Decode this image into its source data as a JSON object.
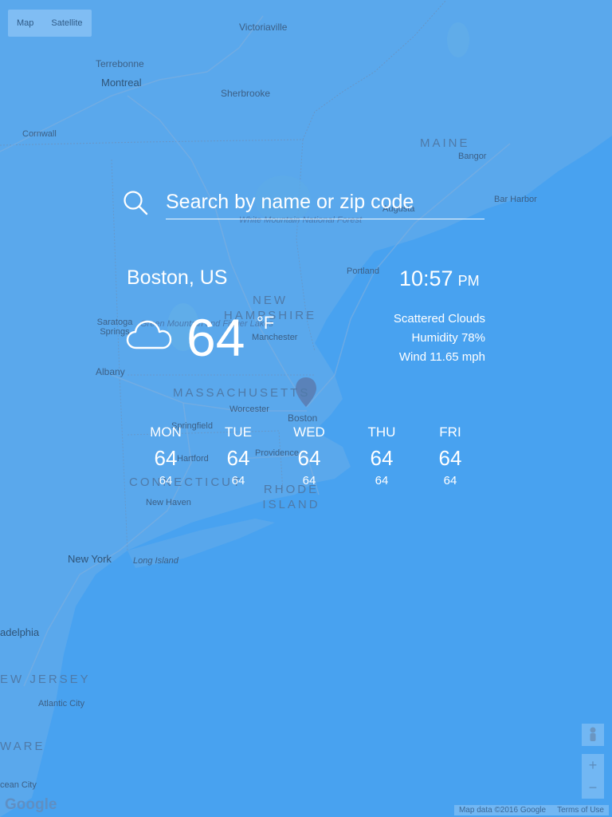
{
  "map": {
    "type_buttons": [
      "Map",
      "Satellite"
    ],
    "labels": {
      "victoriaville": "Victoriaville",
      "terrebonne": "Terrebonne",
      "montreal": "Montreal",
      "sherbrooke": "Sherbrooke",
      "cornwall": "Cornwall",
      "maine": "MAINE",
      "bangor": "Bangor",
      "bar_harbor": "Bar Harbor",
      "augusta": "Augusta",
      "white_mountain": "White Mountain National Forest",
      "portland": "Portland",
      "new_hampshire": "NEW HAMPSHIRE",
      "saratoga": "Saratoga Springs",
      "green_mountain": "Green Mountain and Finger Lakes",
      "manchester": "Manchester",
      "albany": "Albany",
      "massachusetts": "MASSACHUSETTS",
      "worcester": "Worcester",
      "boston": "Boston",
      "springfield": "Springfield",
      "hartford": "Hartford",
      "providence": "Providence",
      "connecticut": "CONNECTICUT",
      "rhode_island": "RHODE ISLAND",
      "new_haven": "New Haven",
      "new_york": "New York",
      "long_island": "Long Island",
      "philadelphia": "adelphia",
      "new_jersey": "EW JERSEY",
      "atlantic_city": "Atlantic City",
      "delaware": "WARE",
      "ocean_city": "cean City"
    },
    "google_logo": "Google",
    "attribution": "Map data ©2016 Google",
    "terms": "Terms of Use",
    "zoom_in": "+",
    "zoom_out": "−"
  },
  "search": {
    "placeholder": "Search by name or zip code"
  },
  "weather": {
    "city": "Boston, US",
    "time": "10:57",
    "ampm": "PM",
    "condition_icon": "cloud-icon",
    "temperature": "64",
    "unit": "°F",
    "condition": "Scattered Clouds",
    "humidity": "Humidity 78%",
    "wind": "Wind 11.65 mph"
  },
  "forecast": [
    {
      "day": "MON",
      "high": "64",
      "low": "64"
    },
    {
      "day": "TUE",
      "high": "64",
      "low": "64"
    },
    {
      "day": "WED",
      "high": "64",
      "low": "64"
    },
    {
      "day": "THU",
      "high": "64",
      "low": "64"
    },
    {
      "day": "FRI",
      "high": "64",
      "low": "64"
    }
  ],
  "colors": {
    "overlay": "#49a3f0",
    "land": "#5aa8ec",
    "water": "#48a2f0",
    "text": "#ffffff"
  }
}
